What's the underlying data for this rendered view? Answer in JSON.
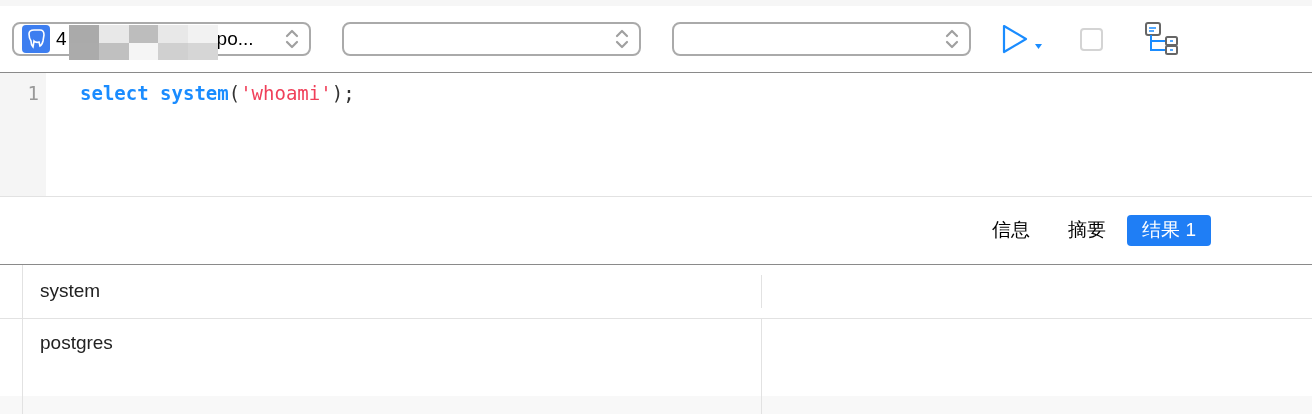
{
  "toolbar": {
    "selects": [
      {
        "kind": "connection",
        "value_start": "4",
        "value_end": "po..."
      },
      {
        "kind": "empty"
      },
      {
        "kind": "empty"
      }
    ],
    "stop_enabled": false
  },
  "editor": {
    "lines": [
      {
        "number": "1",
        "tokens": [
          {
            "kind": "keyword",
            "text": "select system"
          },
          {
            "kind": "plain",
            "text": "("
          },
          {
            "kind": "string",
            "text": "'whoami'"
          },
          {
            "kind": "plain",
            "text": ");"
          }
        ]
      }
    ]
  },
  "result_tabs": [
    {
      "label": "信息",
      "selected": false
    },
    {
      "label": "摘要",
      "selected": false
    },
    {
      "label": "结果 1",
      "selected": true
    }
  ],
  "table": {
    "columns": [
      "system"
    ],
    "rows": [
      [
        "postgres"
      ]
    ]
  }
}
